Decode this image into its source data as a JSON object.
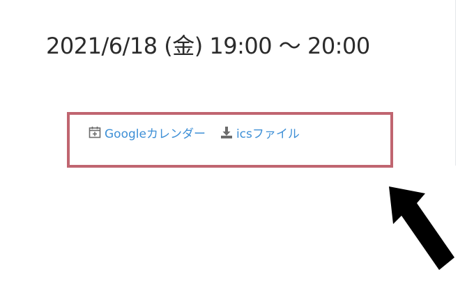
{
  "event": {
    "datetime": "2021/6/18 (金) 19:00 〜 20:00"
  },
  "links": {
    "google_calendar": {
      "label": "Googleカレンダー",
      "icon": "calendar-plus-icon"
    },
    "ics_file": {
      "label": "icsファイル",
      "icon": "download-icon"
    }
  },
  "colors": {
    "link": "#3d8fd6",
    "highlight_border": "#c06570",
    "text": "#2b2b2b",
    "arrow": "#000000"
  }
}
